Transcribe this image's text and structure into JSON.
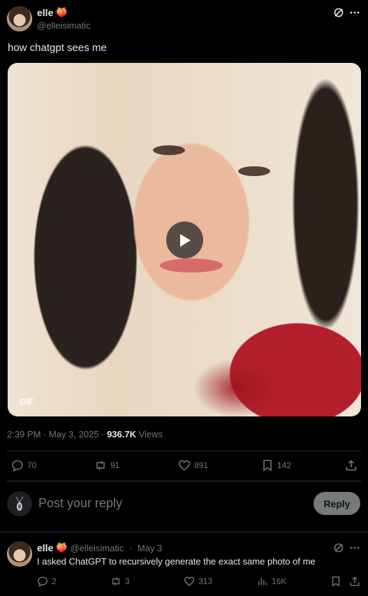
{
  "post": {
    "author_name": "elle",
    "author_emoji": "🍑",
    "author_handle": "@elleisimatic",
    "text": "how chatgpt sees me",
    "media_badge": "GIF",
    "timestamp": "2:39 PM · May 3, 2025 · ",
    "views_count": "936.7K",
    "views_label": " Views",
    "stats": {
      "replies": "70",
      "reposts": "91",
      "likes": "891",
      "bookmarks": "142"
    }
  },
  "composer": {
    "placeholder": "Post your reply",
    "reply_button": "Reply"
  },
  "reply": {
    "author_name": "elle",
    "author_emoji": "🍑",
    "author_handle": "@elleisimatic",
    "separator": " · ",
    "date": "May 3",
    "text": "I asked ChatGPT to recursively generate the exact same photo of me",
    "stats": {
      "replies": "2",
      "reposts": "3",
      "likes": "313",
      "views": "16K"
    }
  },
  "icons": {
    "grok": "grok-icon",
    "more": "more-icon",
    "reply": "reply-icon",
    "repost": "repost-icon",
    "like": "like-icon",
    "bookmark": "bookmark-icon",
    "share": "share-icon",
    "views": "views-icon",
    "play": "play-icon"
  }
}
